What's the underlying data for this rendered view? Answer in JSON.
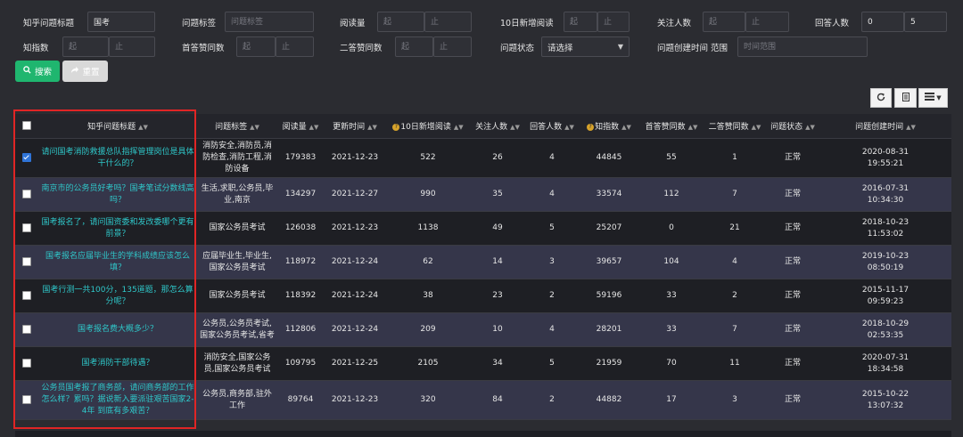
{
  "filters": {
    "title": {
      "label": "知乎问题标题",
      "value": "国考"
    },
    "tags": {
      "label": "问题标签",
      "placeholder": "问题标签"
    },
    "reads": {
      "label": "阅读量",
      "from": "起",
      "to": "止"
    },
    "new_reads": {
      "label": "10日新增阅读",
      "from": "起",
      "to": "止"
    },
    "followers": {
      "label": "关注人数",
      "from": "起",
      "to": "止"
    },
    "answers": {
      "label": "回答人数",
      "from": "0",
      "to": "5"
    },
    "zhi_index": {
      "label": "知指数",
      "from": "起",
      "to": "止"
    },
    "first_likes": {
      "label": "首答赞同数",
      "from": "起",
      "to": "止"
    },
    "second_likes": {
      "label": "二答赞同数",
      "from": "起",
      "to": "止"
    },
    "status": {
      "label": "问题状态",
      "value": "请选择"
    },
    "created": {
      "label": "问题创建时间 范围",
      "placeholder": "时间范围"
    }
  },
  "buttons": {
    "search": "搜索",
    "reset": "重置"
  },
  "table": {
    "headers": [
      "知乎问题标题",
      "问题标签",
      "阅读量",
      "更新时间",
      "10日新增阅读",
      "关注人数",
      "回答人数",
      "知指数",
      "首答赞同数",
      "二答赞同数",
      "问题状态",
      "问题创建时间"
    ],
    "rows": [
      {
        "checked": true,
        "title": "请问国考消防救援总队指挥管理岗位是具体干什么的？",
        "tags": "消防安全,消防员,消防检查,消防工程,消防设备",
        "reads": "179383",
        "updated": "2021-12-23",
        "new_reads": "522",
        "followers": "26",
        "answers": "4",
        "zhi": "44845",
        "first": "55",
        "second": "1",
        "status": "正常",
        "date": "2020-08-31",
        "time": "19:55:21"
      },
      {
        "checked": false,
        "title": "南京市的公务员好考吗？国考笔试分数线高吗？",
        "tags": "生活,求职,公务员,毕业,南京",
        "reads": "134297",
        "updated": "2021-12-27",
        "new_reads": "990",
        "followers": "35",
        "answers": "4",
        "zhi": "33574",
        "first": "112",
        "second": "7",
        "status": "正常",
        "date": "2016-07-31",
        "time": "10:34:30"
      },
      {
        "checked": false,
        "title": "国考报名了，请问国资委和发改委哪个更有前景？",
        "tags": "国家公务员考试",
        "reads": "126038",
        "updated": "2021-12-23",
        "new_reads": "1138",
        "followers": "49",
        "answers": "5",
        "zhi": "25207",
        "first": "0",
        "second": "21",
        "status": "正常",
        "date": "2018-10-23",
        "time": "11:53:02"
      },
      {
        "checked": false,
        "title": "国考报名应届毕业生的学科成绩应该怎么填？",
        "tags": "应届毕业生,毕业生,国家公务员考试",
        "reads": "118972",
        "updated": "2021-12-24",
        "new_reads": "62",
        "followers": "14",
        "answers": "3",
        "zhi": "39657",
        "first": "104",
        "second": "4",
        "status": "正常",
        "date": "2019-10-23",
        "time": "08:50:19"
      },
      {
        "checked": false,
        "title": "国考行测一共100分，135道题，那怎么算分呢？",
        "tags": "国家公务员考试",
        "reads": "118392",
        "updated": "2021-12-24",
        "new_reads": "38",
        "followers": "23",
        "answers": "2",
        "zhi": "59196",
        "first": "33",
        "second": "2",
        "status": "正常",
        "date": "2015-11-17",
        "time": "09:59:23"
      },
      {
        "checked": false,
        "title": "国考报名费大概多少？",
        "tags": "公务员,公务员考试,国家公务员考试,省考",
        "reads": "112806",
        "updated": "2021-12-24",
        "new_reads": "209",
        "followers": "10",
        "answers": "4",
        "zhi": "28201",
        "first": "33",
        "second": "7",
        "status": "正常",
        "date": "2018-10-29",
        "time": "02:53:35"
      },
      {
        "checked": false,
        "title": "国考消防干部待遇？",
        "tags": "消防安全,国家公务员,国家公务员考试",
        "reads": "109795",
        "updated": "2021-12-25",
        "new_reads": "2105",
        "followers": "34",
        "answers": "5",
        "zhi": "21959",
        "first": "70",
        "second": "11",
        "status": "正常",
        "date": "2020-07-31",
        "time": "18:34:58"
      },
      {
        "checked": false,
        "title": "公务员国考报了商务部，请问商务部的工作怎么样？累吗？据说新入要派驻艰苦国家2-4年 到底有多艰苦？",
        "tags": "公务员,商务部,驻外工作",
        "reads": "89764",
        "updated": "2021-12-23",
        "new_reads": "320",
        "followers": "84",
        "answers": "2",
        "zhi": "44882",
        "first": "17",
        "second": "3",
        "status": "正常",
        "date": "2015-10-22",
        "time": "13:07:32"
      }
    ]
  }
}
